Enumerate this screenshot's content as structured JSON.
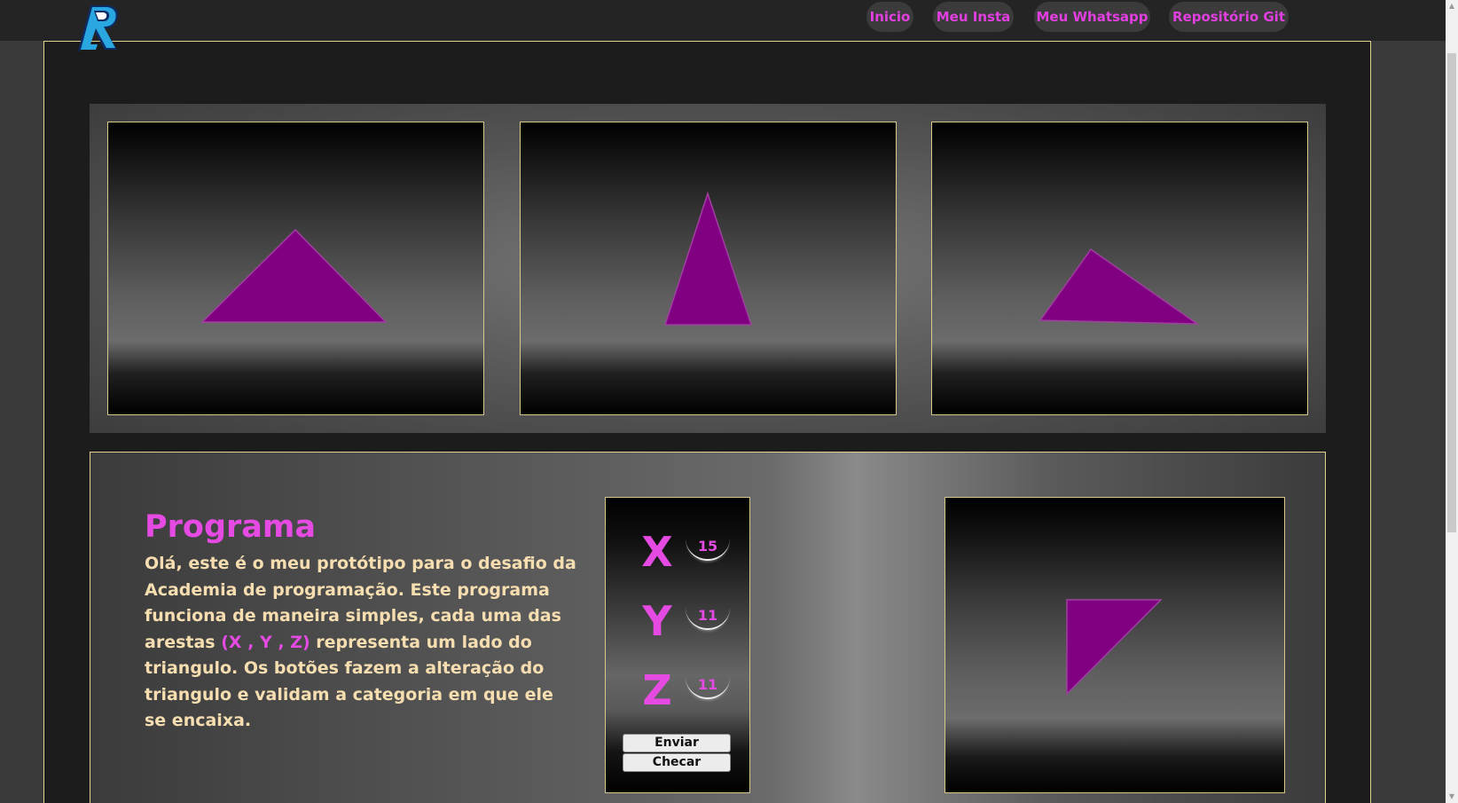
{
  "logo": {
    "letter": "R",
    "icon": "r-logo-icon",
    "colors": [
      "#27a9e1",
      "#0c2f6e",
      "#ffffff"
    ]
  },
  "nav": {
    "items": [
      {
        "label": "Inicio"
      },
      {
        "label": "Meu Insta"
      },
      {
        "label": "Meu Whatsapp"
      },
      {
        "label": "Repositório Git"
      }
    ],
    "text_color": "#e23fe0"
  },
  "gallery": {
    "triangles": [
      {
        "name": "equilateral-like",
        "color": "#810081"
      },
      {
        "name": "isosceles",
        "color": "#810081"
      },
      {
        "name": "scalene",
        "color": "#810081"
      }
    ]
  },
  "program": {
    "title": "Programa",
    "text_before": "Olá, este é o meu protótipo para o desafio da Academia de programação. Este programa funciona de maneira simples, cada uma das arestas ",
    "highlight": "(X , Y , Z)",
    "text_after": " representa um lado do triangulo. Os botões fazem a alteração do triangulo e validam a categoria em que ele se encaixa."
  },
  "controls": {
    "x": {
      "label": "X",
      "value": "15"
    },
    "y": {
      "label": "Y",
      "value": "11"
    },
    "z": {
      "label": "Z",
      "value": "11"
    },
    "send_label": "Enviar",
    "check_label": "Checar"
  },
  "result": {
    "shape": "right-triangle",
    "color": "#810081"
  },
  "colors": {
    "accent": "#e54be2",
    "border": "#e2d18f",
    "text": "#f6deb0"
  }
}
